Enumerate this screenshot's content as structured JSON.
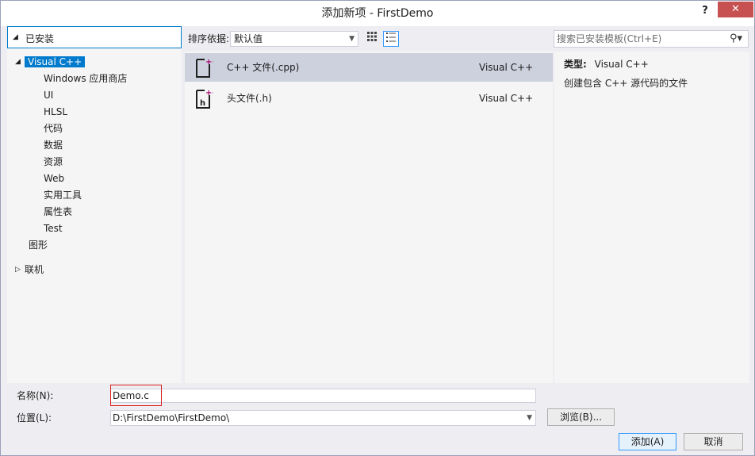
{
  "window": {
    "title": "添加新项 - FirstDemo",
    "help_label": "?",
    "close_label": "✕"
  },
  "tree": {
    "header": "已安装",
    "items": [
      {
        "label": "Visual C++",
        "level": 0,
        "expanded": true,
        "selected": true
      },
      {
        "label": "Windows 应用商店",
        "level": 1
      },
      {
        "label": "UI",
        "level": 1
      },
      {
        "label": "HLSL",
        "level": 1
      },
      {
        "label": "代码",
        "level": 1
      },
      {
        "label": "数据",
        "level": 1
      },
      {
        "label": "资源",
        "level": 1
      },
      {
        "label": "Web",
        "level": 1
      },
      {
        "label": "实用工具",
        "level": 1
      },
      {
        "label": "属性表",
        "level": 1
      },
      {
        "label": "Test",
        "level": 1
      },
      {
        "label": "图形",
        "level": 0
      },
      {
        "label": "联机",
        "level": -1,
        "collapsed": true
      }
    ]
  },
  "toolbar": {
    "sort_label": "排序依据:",
    "sort_value": "默认值"
  },
  "templates": [
    {
      "name": "C++ 文件(.cpp)",
      "type": "Visual C++",
      "selected": true,
      "icon": "cpp-file-icon"
    },
    {
      "name": "头文件(.h)",
      "type": "Visual C++",
      "selected": false,
      "icon": "header-file-icon"
    }
  ],
  "search": {
    "placeholder": "搜索已安装模板(Ctrl+E)"
  },
  "details": {
    "type_label": "类型:",
    "type_value": "Visual C++",
    "description": "创建包含 C++ 源代码的文件"
  },
  "form": {
    "name_label": "名称(N):",
    "name_value": "Demo.c",
    "location_label": "位置(L):",
    "location_value": "D:\\FirstDemo\\FirstDemo\\",
    "browse_label": "浏览(B)...",
    "add_label": "添加(A)",
    "cancel_label": "取消"
  },
  "colors": {
    "accent": "#007acc",
    "highlight": "#d9201f",
    "icon_accent": "#a3006e"
  }
}
